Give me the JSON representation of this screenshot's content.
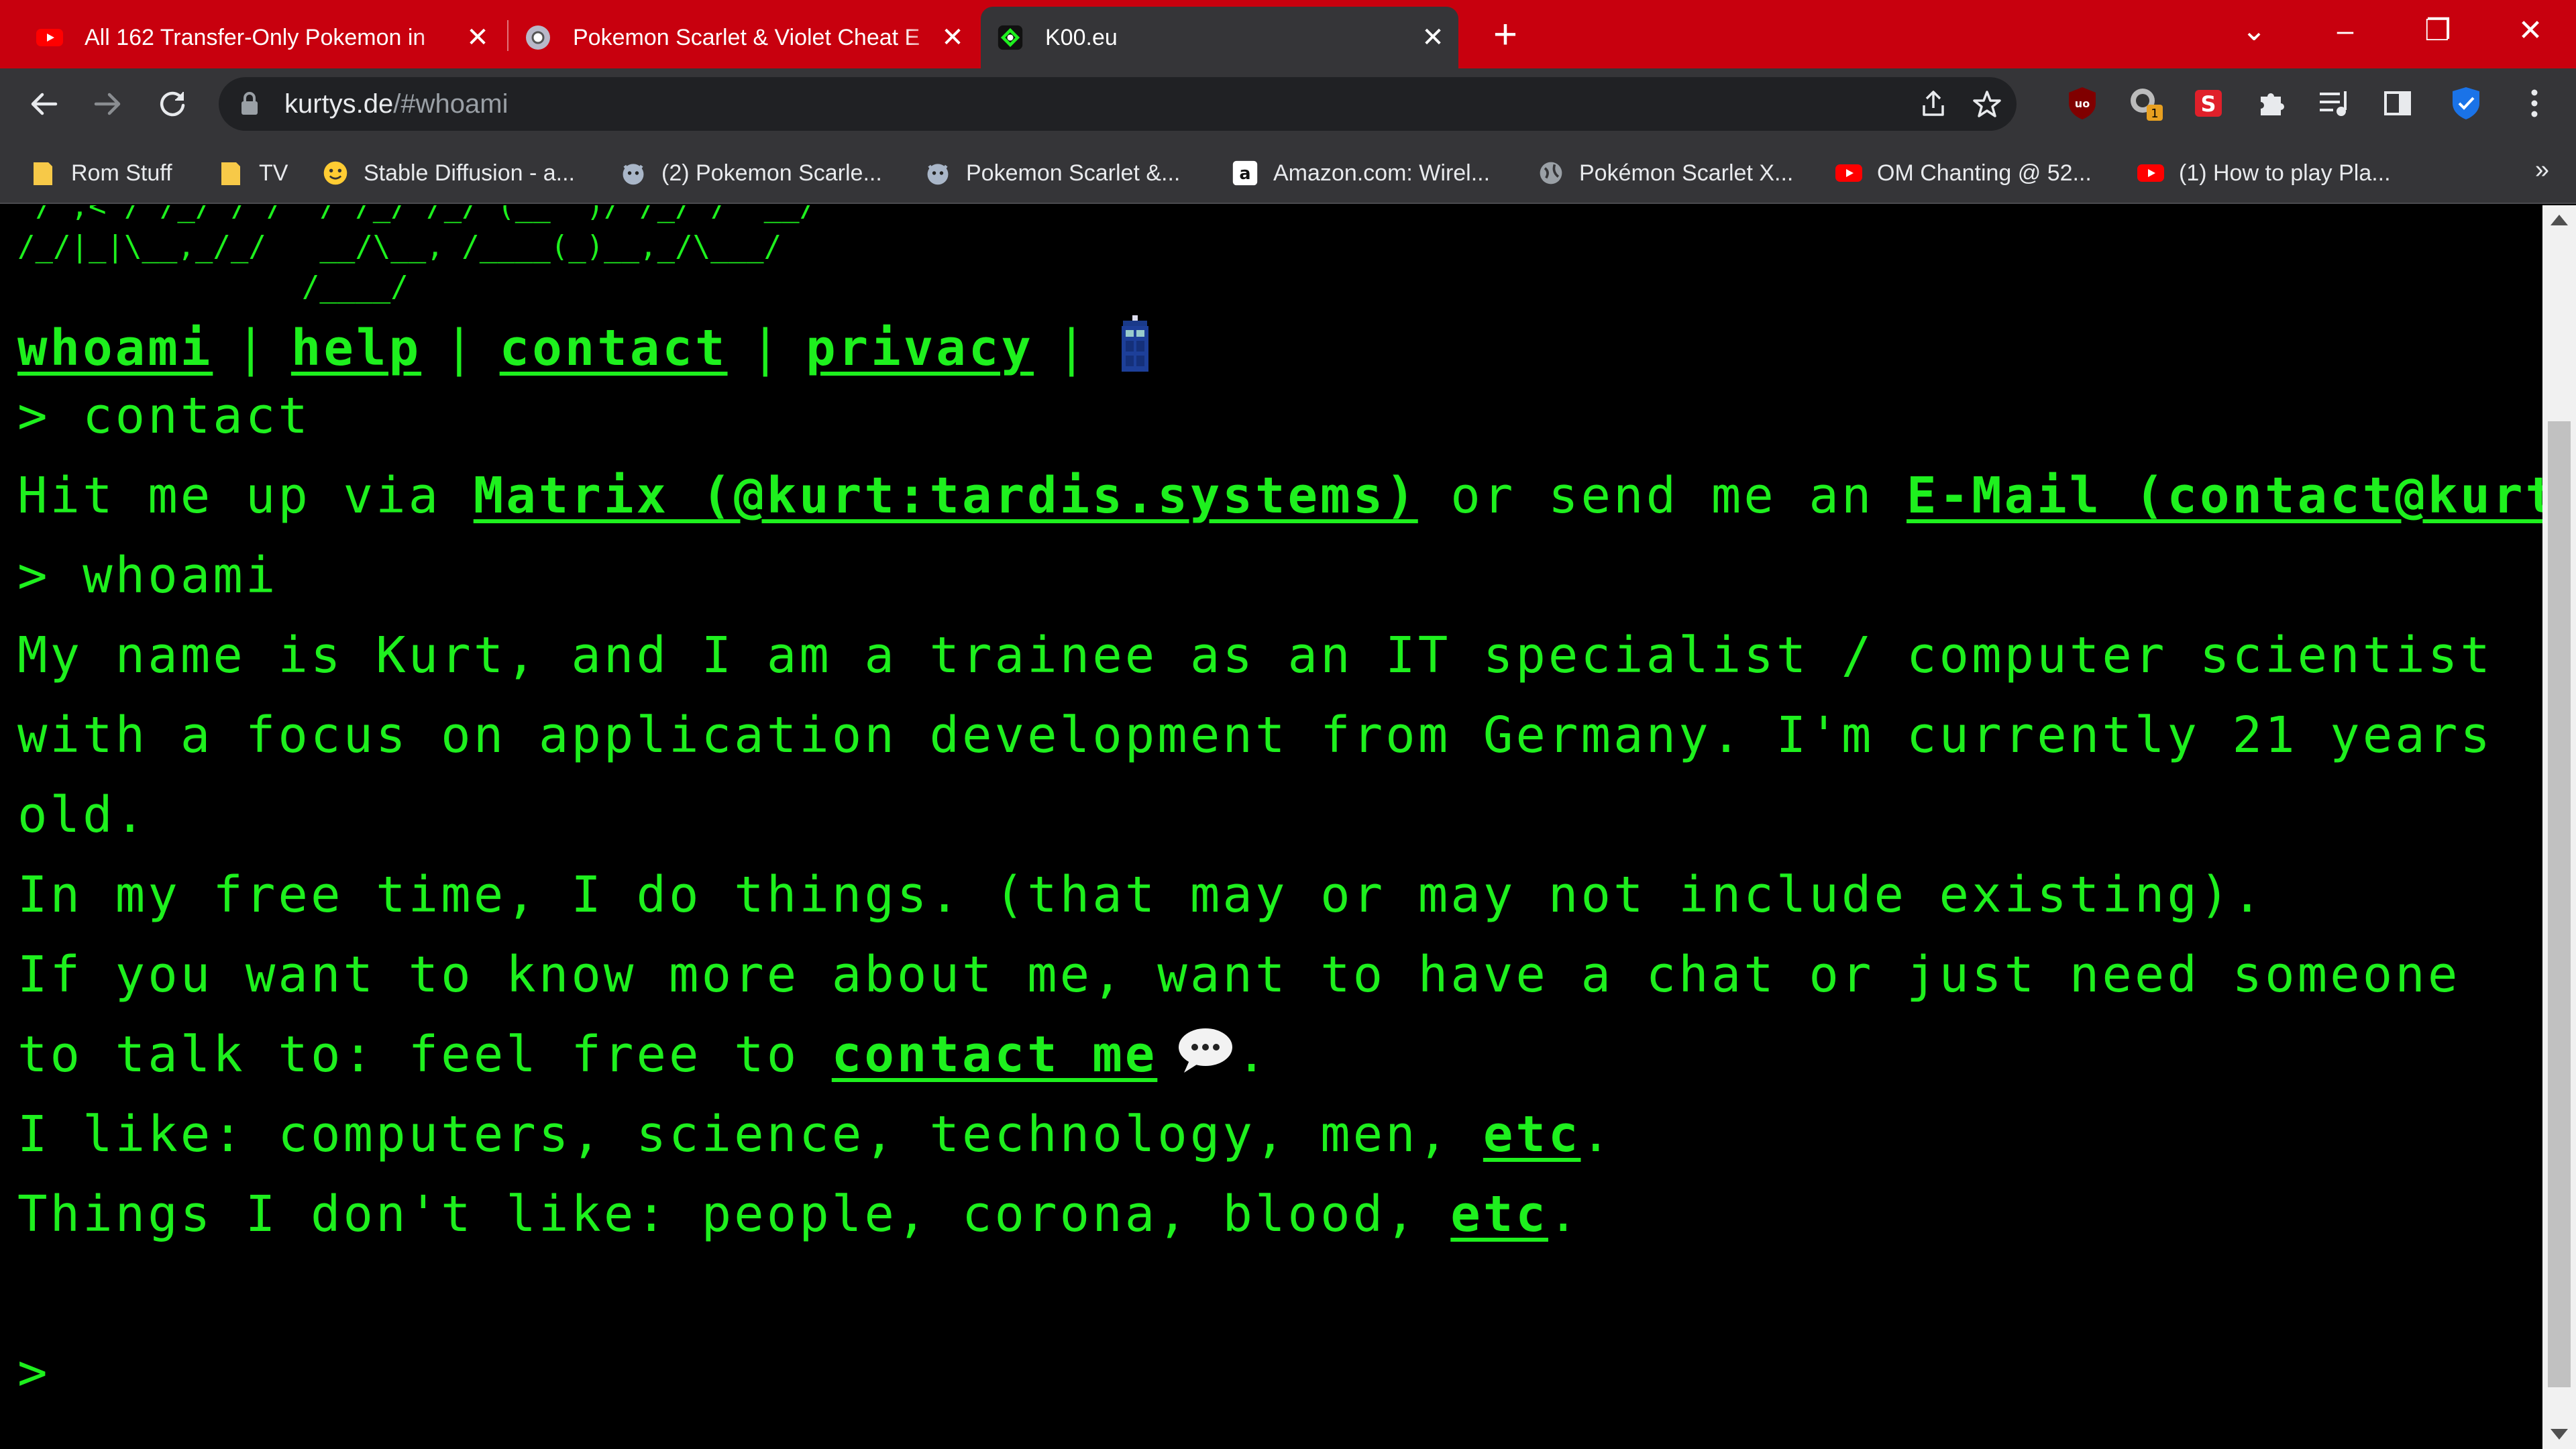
{
  "tabs": [
    {
      "title": "All 162 Transfer-Only Pokemon in",
      "favicon": "youtube-icon",
      "active": false
    },
    {
      "title": "Pokemon Scarlet & Violet Cheat E",
      "favicon": "pokeball-icon",
      "active": false
    },
    {
      "title": "K00.eu",
      "favicon": "k00-icon",
      "active": true
    }
  ],
  "window_controls": {
    "tab_search": "⌄",
    "minimize": "–",
    "restore": "❐",
    "close": "✕"
  },
  "toolbar": {
    "url_host": "kurtys.de",
    "url_path": "/#whoami",
    "extension_badge": "1"
  },
  "bookmarks": [
    {
      "label": "Rom Stuff",
      "icon": "folder-icon"
    },
    {
      "label": "TV",
      "icon": "folder-icon"
    },
    {
      "label": "Stable Diffusion - a...",
      "icon": "hugging-face-icon"
    },
    {
      "label": "(2) Pokemon Scarle...",
      "icon": "pokemon-icon"
    },
    {
      "label": "Pokemon Scarlet &...",
      "icon": "pokemon-icon"
    },
    {
      "label": "Amazon.com: Wirel...",
      "icon": "amazon-icon"
    },
    {
      "label": "Pokémon Scarlet X...",
      "icon": "globe-icon"
    },
    {
      "label": "OM Chanting @ 52...",
      "icon": "youtube-icon"
    },
    {
      "label": "(1) How to play Pla...",
      "icon": "youtube-icon"
    }
  ],
  "bookmarks_more": "»",
  "terminal": {
    "ascii_art": " / ,< / /_/ / /  / /_/ /_/ (__  )/ /_/ /  __/\n/_/|_|\\__,_/_/   __/\\__, /____(_)__,_/\\___/\n                /____/",
    "nav": {
      "whoami": "whoami",
      "help": "help",
      "contact": "contact",
      "privacy": "privacy",
      "separator": "|"
    },
    "prompt_contact": "> contact",
    "contact_prefix": "Hit me up via ",
    "contact_matrix": "Matrix (@kurt:tardis.systems)",
    "contact_middle": " or send me an ",
    "contact_email": "E-Mail (contact@kurtys.de)",
    "prompt_whoami": "> whoami",
    "bio_line1": "My name is Kurt, and I am a trainee as an IT specialist / computer scientist",
    "bio_line2": "with a focus on application development from Germany. I'm currently 21 years",
    "bio_line3": "old.",
    "free_time": "In my free time, I do things. (that may or may not include existing).",
    "more_line1": "If you want to know more about me, want to have a chat or just need someone",
    "more_line2_prefix": "to talk to: feel free to ",
    "more_line2_link": "contact me",
    "more_line2_suffix": ".",
    "likes_prefix": "I like: computers, science, technology, men, ",
    "likes_link": "etc",
    "likes_suffix": ".",
    "dislikes_prefix": "Things I don't like: people, corona, blood, ",
    "dislikes_link": "etc",
    "dislikes_suffix": ".",
    "prompt_empty": ">"
  },
  "colors": {
    "accent": "#c8000e",
    "terminal_green": "#1ef01e",
    "toolbar": "#353538"
  }
}
